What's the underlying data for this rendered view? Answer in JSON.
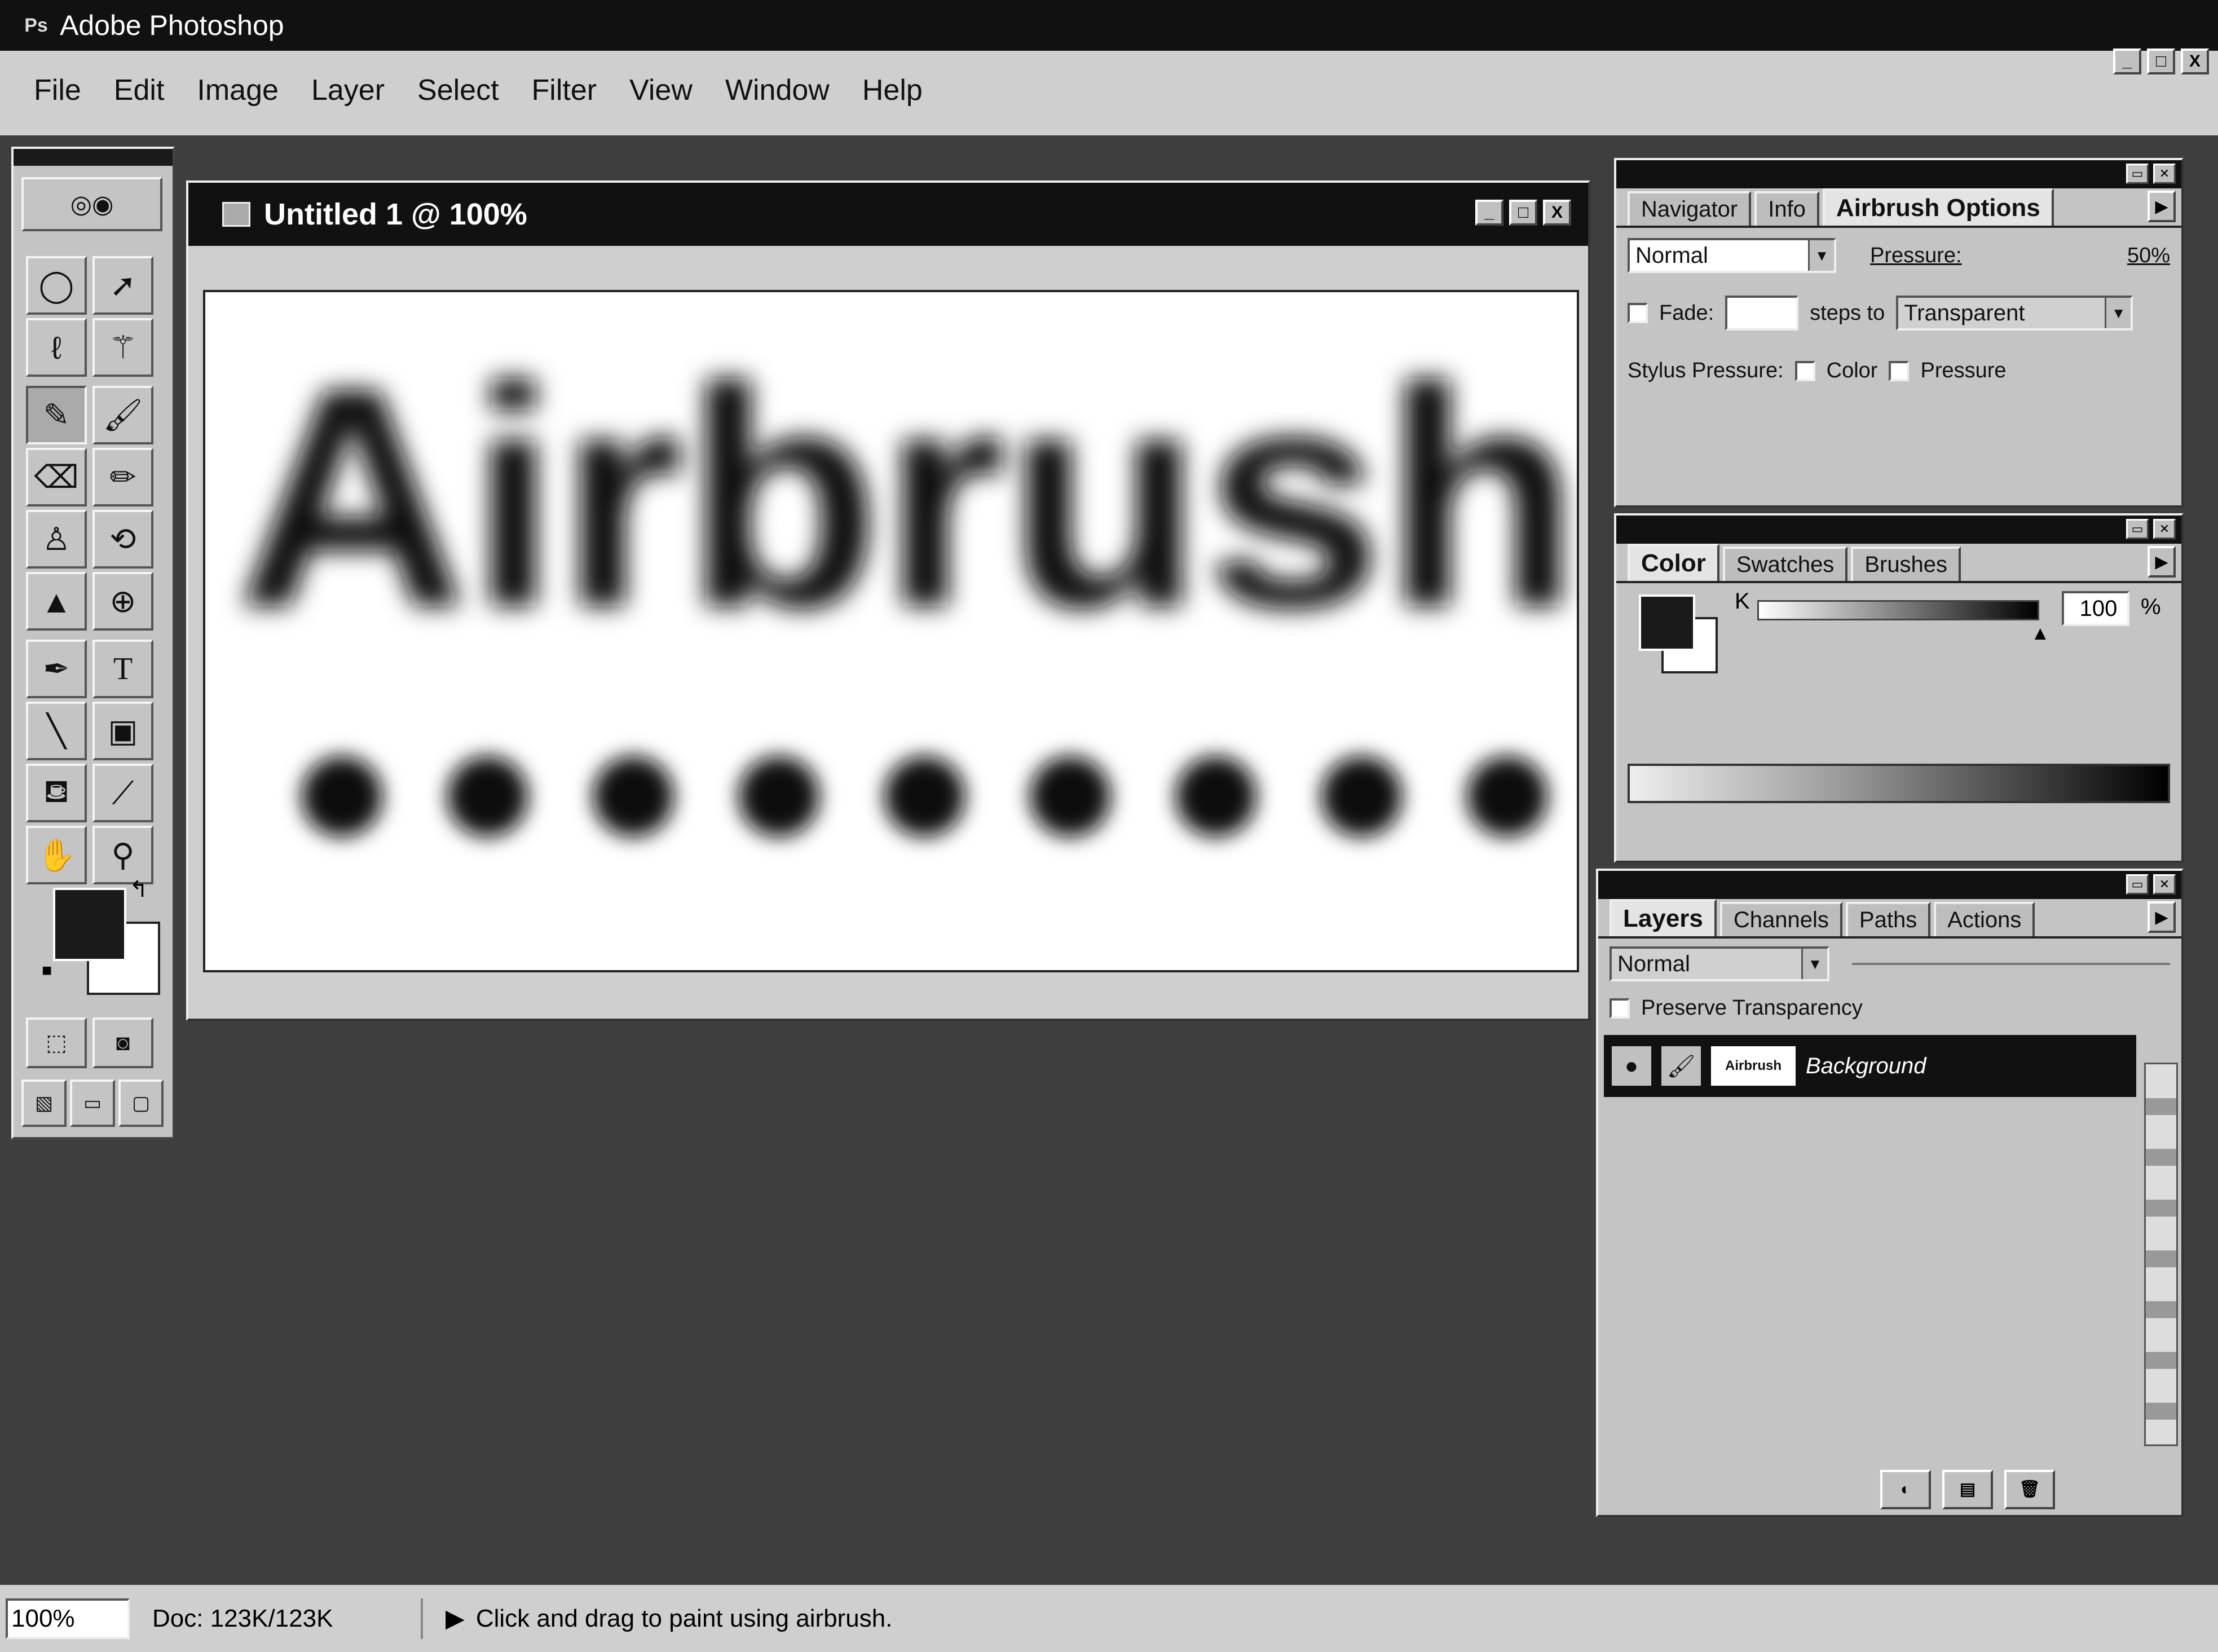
{
  "app": {
    "title": "Adobe Photoshop",
    "icon": "Ps"
  },
  "window_controls": {
    "minimize": "_",
    "maximize": "□",
    "close": "X"
  },
  "menu": [
    "File",
    "Edit",
    "Image",
    "Layer",
    "Select",
    "Filter",
    "View",
    "Window",
    "Help"
  ],
  "toolbox": {
    "tools": [
      "marquee-tool",
      "ellipse-marquee-tool",
      "move-tool",
      "lasso-tool",
      "magic-wand-tool",
      "airbrush-tool",
      "paintbrush-tool",
      "eraser-tool",
      "pencil-tool",
      "rubber-stamp-tool",
      "history-brush-tool",
      "blur-tool",
      "dodge-tool",
      "pen-tool",
      "type-tool",
      "line-tool",
      "gradient-tool",
      "paint-bucket-tool",
      "eyedropper-tool",
      "hand-tool",
      "zoom-tool",
      "standard-mode",
      "quick-mask-mode",
      "standard-screen-mode",
      "full-screen-menu-mode",
      "full-screen-mode"
    ],
    "foreground_color": "#1a1a1a",
    "background_color": "#ffffff"
  },
  "document": {
    "title": "Untitled 1 @ 100%",
    "canvas_text": "Airbrush",
    "dot_count": 9
  },
  "navigator_panel": {
    "tabs": [
      "Navigator",
      "Info",
      "Airbrush Options"
    ],
    "active_tab": "Airbrush Options",
    "mode": "Normal",
    "pressure_label": "Pressure:",
    "pressure_value": "50%",
    "fade_label": "Fade:",
    "fade_steps_label": "steps to",
    "fade_to": "Transparent",
    "stylus_label": "Stylus Pressure:",
    "stylus_color": "Color",
    "stylus_pressure": "Pressure"
  },
  "color_panel": {
    "tabs": [
      "Color",
      "Swatches",
      "Brushes"
    ],
    "active_tab": "Color",
    "channel": "K",
    "value": "100",
    "unit": "%"
  },
  "layers_panel": {
    "tabs": [
      "Layers",
      "Channels",
      "Paths",
      "Actions"
    ],
    "active_tab": "Layers",
    "blend_mode": "Normal",
    "preserve_label": "Preserve Transparency",
    "layer_name": "Background"
  },
  "status": {
    "zoom": "100%",
    "doc_size": "Doc: 123K/123K",
    "hint": "Click and drag to paint using airbrush."
  }
}
